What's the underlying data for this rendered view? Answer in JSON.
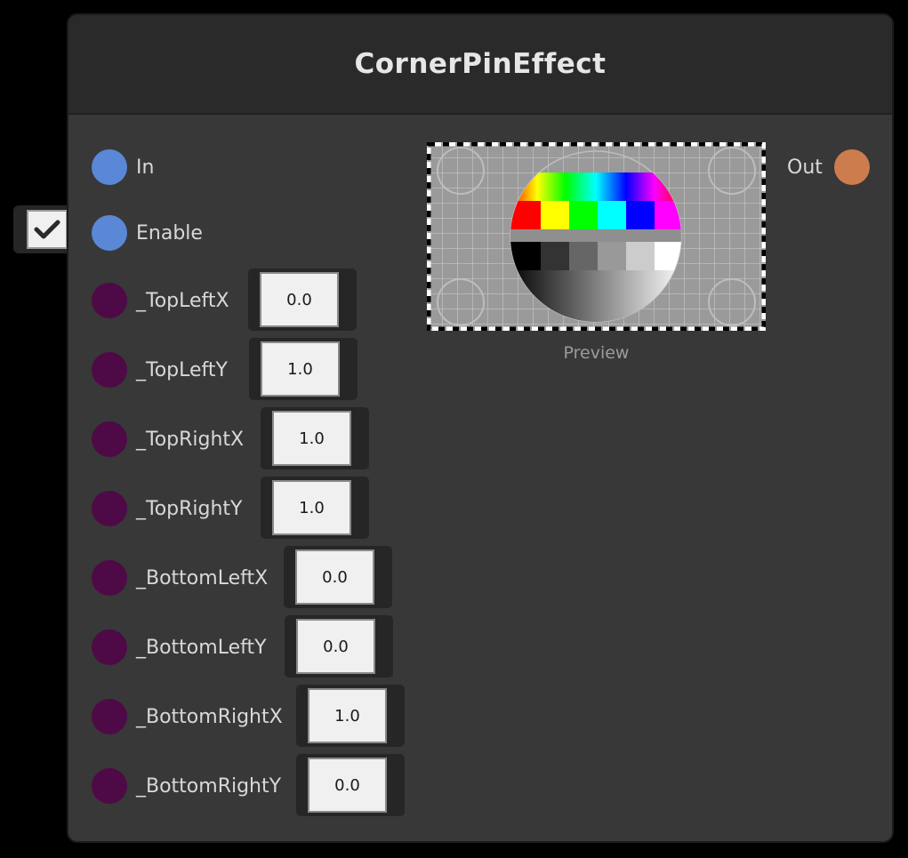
{
  "node": {
    "title": "CornerPinEffect",
    "input_ports": [
      {
        "label": "In"
      },
      {
        "label": "Enable",
        "checked": true
      }
    ],
    "output_port": {
      "label": "Out"
    },
    "parameters": [
      {
        "label": "_TopLeftX",
        "value": "0.0"
      },
      {
        "label": "_TopLeftY",
        "value": "1.0"
      },
      {
        "label": "_TopRightX",
        "value": "1.0"
      },
      {
        "label": "_TopRightY",
        "value": "1.0"
      },
      {
        "label": "_BottomLeftX",
        "value": "0.0"
      },
      {
        "label": "_BottomLeftY",
        "value": "0.0"
      },
      {
        "label": "_BottomRightX",
        "value": "1.0"
      },
      {
        "label": "_BottomRightY",
        "value": "0.0"
      }
    ],
    "preview": {
      "caption": "Preview"
    }
  },
  "colors": {
    "port_input": "#5a87d6",
    "port_param": "#4d0a46",
    "port_output": "#cd7c4e"
  },
  "icons": {
    "checkbox": "checkmark-icon"
  }
}
